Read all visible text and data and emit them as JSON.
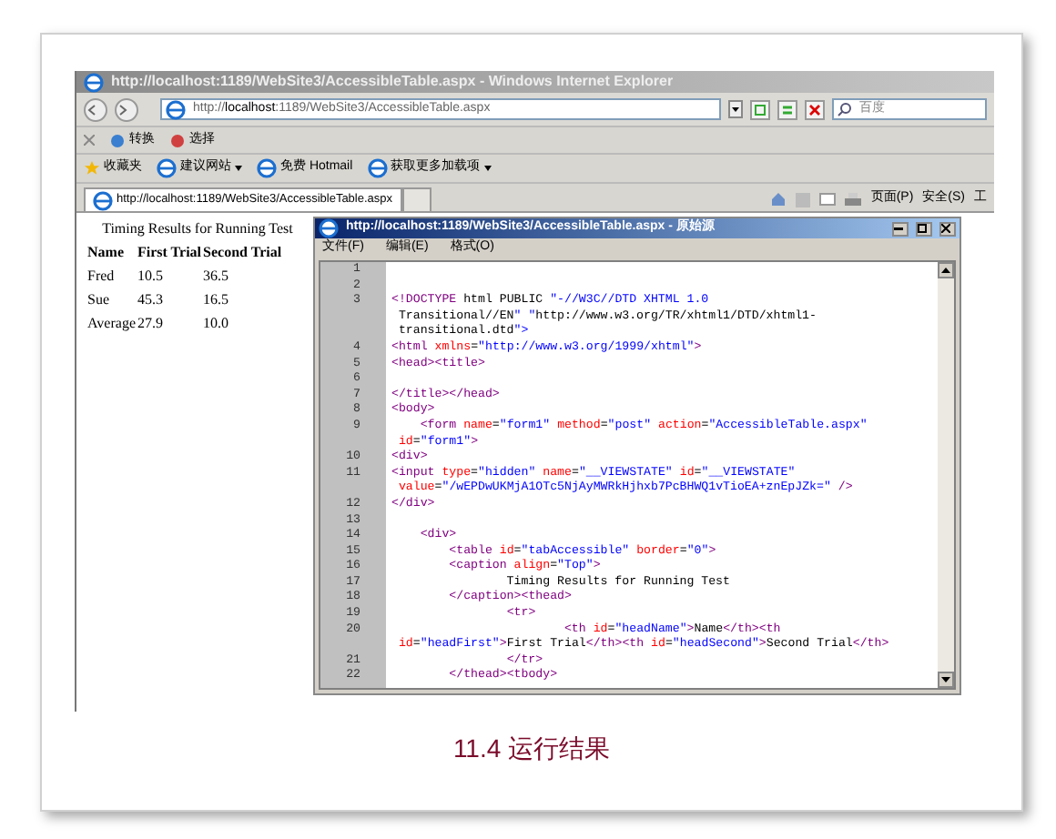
{
  "browser": {
    "title": "http://localhost:1189/WebSite3/AccessibleTable.aspx - Windows Internet Explorer",
    "address_prefix": "http://",
    "address_host": "localhost",
    "address_rest": ":1189/WebSite3/AccessibleTable.aspx",
    "search_placeholder": "百度",
    "toolbar": [
      "转换",
      "选择"
    ],
    "favorites": [
      {
        "label": "收藏夹",
        "dropdown": false
      },
      {
        "label": "建议网站",
        "dropdown": true
      },
      {
        "label": "免费 Hotmail",
        "dropdown": false
      },
      {
        "label": "获取更多加载项",
        "dropdown": true
      }
    ],
    "tab": "http://localhost:1189/WebSite3/AccessibleTable.aspx",
    "commands": [
      "页面(P)",
      "安全(S)",
      "工"
    ]
  },
  "page_table": {
    "caption": "Timing Results for Running Test",
    "columns": [
      "Name",
      "First Trial",
      "Second Trial"
    ],
    "rows": [
      [
        "Fred",
        "10.5",
        "36.5"
      ],
      [
        "Sue",
        "45.3",
        "16.5"
      ],
      [
        "Average",
        "27.9",
        "10.0"
      ]
    ]
  },
  "source_window": {
    "title": "http://localhost:1189/WebSite3/AccessibleTable.aspx - 原始源",
    "menu": [
      "文件(F)",
      "编辑(E)",
      "格式(O)"
    ],
    "lines": [
      {
        "number": "1"
      },
      {
        "number": "2"
      },
      {
        "number": "3",
        "text": [
          "<!DOCTYPE html PUBLIC \"-//W3C//DTD XHTML 1.0",
          " Transitional//EN\" \"http://www.w3.org/TR/xhtml1/DTD/xhtml1-",
          " transitional.dtd\">"
        ]
      },
      {
        "number": "4",
        "text": [
          "<html xmlns=\"http://www.w3.org/1999/xhtml\">"
        ]
      },
      {
        "number": "5",
        "text": [
          "<head><title>"
        ]
      },
      {
        "number": "6"
      },
      {
        "number": "7",
        "text": [
          "</title></head>"
        ]
      },
      {
        "number": "8",
        "text": [
          "<body>"
        ]
      },
      {
        "number": "9",
        "text": [
          "    <form name=\"form1\" method=\"post\" action=\"AccessibleTable.aspx\"",
          " id=\"form1\">"
        ]
      },
      {
        "number": "10",
        "text": [
          "<div>"
        ]
      },
      {
        "number": "11",
        "text": [
          "<input type=\"hidden\" name=\"__VIEWSTATE\" id=\"__VIEWSTATE\"",
          " value=\"/wEPDwUKMjA1OTc5NjAyMWRkHjhxb7PcBHWQ1vTioEA+znEpJZk=\" />"
        ]
      },
      {
        "number": "12",
        "text": [
          "</div>"
        ]
      },
      {
        "number": "13"
      },
      {
        "number": "14",
        "text": [
          "    <div>"
        ]
      },
      {
        "number": "15",
        "text": [
          "        <table id=\"tabAccessible\" border=\"0\">"
        ]
      },
      {
        "number": "16",
        "text": [
          "        <caption align=\"Top\">"
        ]
      },
      {
        "number": "17",
        "text": [
          "                Timing Results for Running Test"
        ]
      },
      {
        "number": "18",
        "text": [
          "        </caption><thead>"
        ]
      },
      {
        "number": "19",
        "text": [
          "                <tr>"
        ]
      },
      {
        "number": "20",
        "text": [
          "                        <th id=\"headName\">Name</th><th",
          " id=\"headFirst\">First Trial</th><th id=\"headSecond\">Second Trial</th>"
        ]
      },
      {
        "number": "21",
        "text": [
          "                </tr>"
        ]
      },
      {
        "number": "22",
        "text": [
          "        </thead><tbody>"
        ]
      }
    ]
  },
  "caption": "11.4 运行结果"
}
